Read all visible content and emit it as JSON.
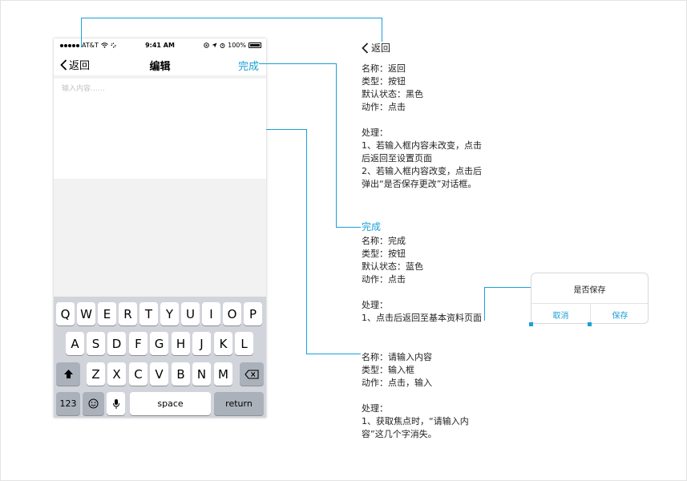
{
  "colors": {
    "accent": "#1aa0d6",
    "keyboard_bg": "#d1d4da",
    "key_gray": "#abb1bb"
  },
  "status_bar": {
    "carrier": "AT&T",
    "time": "9:41 AM",
    "battery": "100%"
  },
  "navbar": {
    "back_label": "返回",
    "title": "编辑",
    "done_label": "完成"
  },
  "input": {
    "placeholder": "输入内容……",
    "value": ""
  },
  "keyboard": {
    "row1": [
      "Q",
      "W",
      "E",
      "R",
      "T",
      "Y",
      "U",
      "I",
      "O",
      "P"
    ],
    "row2": [
      "A",
      "S",
      "D",
      "F",
      "G",
      "H",
      "J",
      "K",
      "L"
    ],
    "row3": [
      "Z",
      "X",
      "C",
      "V",
      "B",
      "N",
      "M"
    ],
    "num_label": "123",
    "space_label": "space",
    "return_label": "return"
  },
  "annotations": {
    "back": {
      "head": "返回",
      "lines": [
        "名称：返回",
        "类型：按钮",
        "默认状态：黑色",
        "动作：点击",
        "",
        "处理：",
        "1、若输入框内容未改变，点击",
        "后返回至设置页面",
        "2、若输入框内容改变，点击后",
        "弹出“是否保存更改”对话框。"
      ]
    },
    "done": {
      "head": "完成",
      "lines": [
        "名称：完成",
        "类型：按钮",
        "默认状态：蓝色",
        "动作：点击",
        "",
        "处理：",
        "1、点击后返回至基本资料页面"
      ]
    },
    "input": {
      "lines": [
        "名称：请输入内容",
        "类型：输入框",
        "动作：点击，输入",
        "",
        "处理：",
        "1、获取焦点时，“请输入内",
        "容”这几个字消失。"
      ]
    }
  },
  "dialog": {
    "title": "是否保存",
    "cancel_label": "取消",
    "save_label": "保存"
  }
}
